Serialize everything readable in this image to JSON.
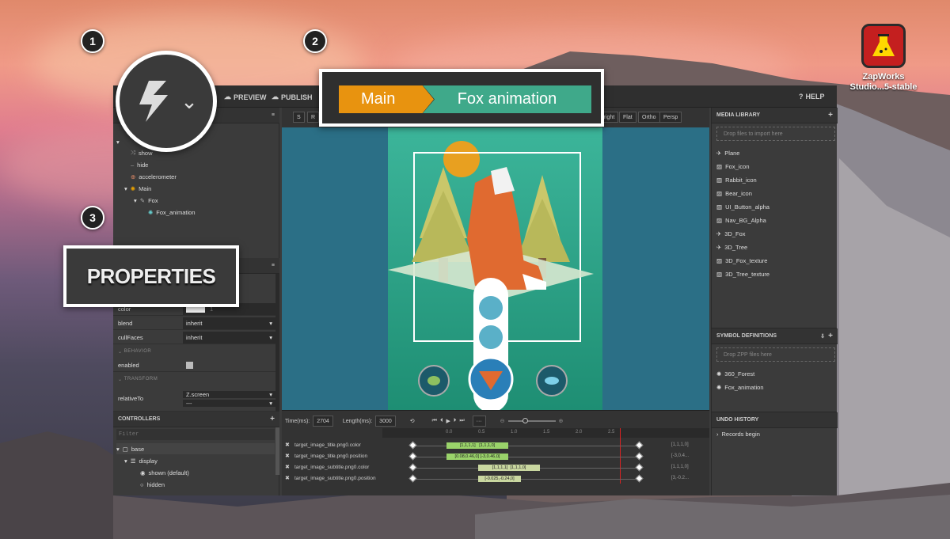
{
  "desktop": {
    "app_icon_name": "zapworks-flask-icon",
    "app_label": "ZapWorks Studio...5-stable"
  },
  "callouts": [
    "1",
    "2",
    "3"
  ],
  "breadcrumb": {
    "main": "Main",
    "current": "Fox animation",
    "main_color": "#e8930f",
    "current_color": "#3fa98a"
  },
  "properties_label": "PROPERTIES",
  "toolbar": {
    "preview": "PREVIEW",
    "publish": "PUBLISH",
    "help": "HELP"
  },
  "viewport_buttons": {
    "s": "S",
    "r": "R",
    "bright": "Bright",
    "flat": "Flat",
    "ortho": "Ortho",
    "persp": "Persp"
  },
  "hierarchy": {
    "items": [
      {
        "label": "show",
        "icon": "shuffle-icon"
      },
      {
        "label": "hide",
        "icon": "dash-icon"
      },
      {
        "label": "accelerometer",
        "icon": "sensor-icon"
      },
      {
        "label": "Main",
        "icon": "gear-icon"
      },
      {
        "label": "Fox",
        "icon": "clip-icon"
      },
      {
        "label": "Fox_animation",
        "icon": "gear-icon"
      }
    ]
  },
  "properties": {
    "color_label": "color",
    "color_value": "1",
    "blend_label": "blend",
    "blend_value": "inherit",
    "cullfaces_label": "cullFaces",
    "cullfaces_value": "inherit",
    "behavior_section": "BEHAVIOR",
    "enabled_label": "enabled",
    "transform_section": "TRANSFORM",
    "relativeto_label": "relativeTo",
    "relativeto_value": "Z.screen",
    "relativeto_value2": "---"
  },
  "controllers": {
    "title": "CONTROLLERS",
    "filter_placeholder": "Filter",
    "items": [
      {
        "label": "base"
      },
      {
        "label": "display"
      },
      {
        "label": "shown (default)"
      },
      {
        "label": "hidden"
      }
    ]
  },
  "media_library": {
    "title": "MEDIA LIBRARY",
    "drop_hint": "Drop files to import here",
    "items": [
      {
        "label": "Plane",
        "icon": "plane-icon"
      },
      {
        "label": "Fox_icon",
        "icon": "image-icon"
      },
      {
        "label": "Rabbit_icon",
        "icon": "image-icon"
      },
      {
        "label": "Bear_icon",
        "icon": "image-icon"
      },
      {
        "label": "UI_Button_alpha",
        "icon": "image-icon"
      },
      {
        "label": "Nav_BG_Alpha",
        "icon": "image-icon"
      },
      {
        "label": "3D_Fox",
        "icon": "plane-icon"
      },
      {
        "label": "3D_Tree",
        "icon": "plane-icon"
      },
      {
        "label": "3D_Fox_texture",
        "icon": "image-icon"
      },
      {
        "label": "3D_Tree_texture",
        "icon": "image-icon"
      }
    ]
  },
  "symbol_definitions": {
    "title": "SYMBOL DEFINITIONS",
    "drop_hint": "Drop ZPP files here",
    "items": [
      {
        "label": "360_Forest"
      },
      {
        "label": "Fox_animation"
      }
    ]
  },
  "undo_history": {
    "title": "UNDO HISTORY",
    "items": [
      {
        "label": "Records begin"
      }
    ]
  },
  "timeline": {
    "time_label": "Time(ms):",
    "time_value": "2704",
    "length_label": "Length(ms):",
    "length_value": "3000",
    "ticks": [
      "0.0",
      "0.5",
      "1.0",
      "1.5",
      "2.0",
      "2.5"
    ],
    "tracks": [
      {
        "label": "target_image_title.png0.color",
        "seg": "[1,1,1,1]",
        "seg2": "[1,1,1,0]",
        "end": "[1,1,1,0]"
      },
      {
        "label": "target_image_title.png0.position",
        "seg": "[0.08,0.46,0]",
        "seg2": "[-3,0.46,0]",
        "end": "[-3,0.4..."
      },
      {
        "label": "target_image_subtitle.png0.color",
        "seg": "[1,1,1,1]",
        "seg2": "[1,1,1,0]",
        "end": "[1,1,1,0]"
      },
      {
        "label": "target_image_subtitle.png0.position",
        "seg": "[-0.025,-0.24,0]",
        "seg2": "",
        "end": "[3,-0.2..."
      }
    ]
  }
}
